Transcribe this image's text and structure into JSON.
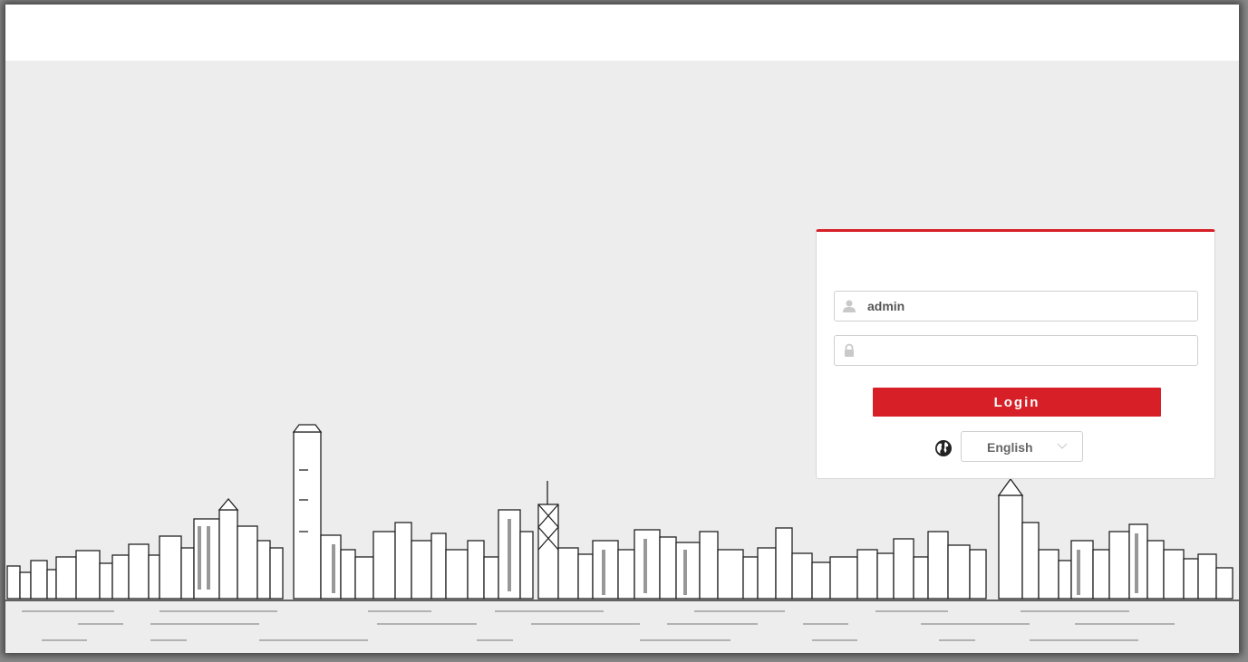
{
  "login": {
    "username_value": "admin",
    "password_value": "",
    "button_label": "Login",
    "language": "English"
  },
  "icons": {
    "user": "user-icon",
    "lock": "lock-icon",
    "globe": "globe-icon",
    "chevron": "chevron-down-icon"
  },
  "colors": {
    "accent": "#d71f27",
    "background": "#ededed",
    "panel": "#ffffff"
  }
}
